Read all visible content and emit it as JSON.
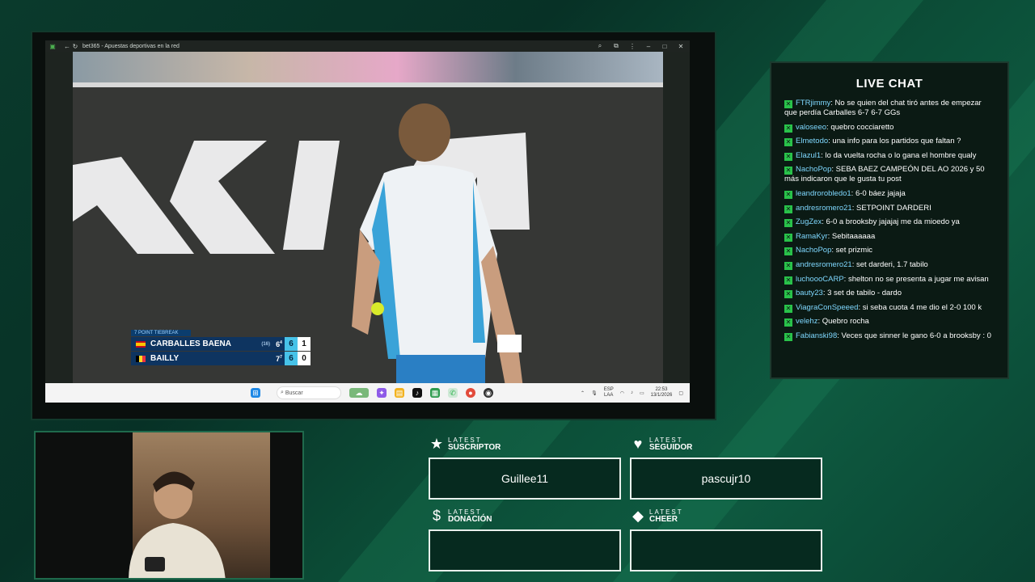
{
  "browser": {
    "title": "bet365 - Apuestas deportivas en la red",
    "taskbar_search": "Buscar",
    "tray_lang_1": "ESP",
    "tray_lang_2": "LAA",
    "time": "22:53",
    "date": "13/1/2026"
  },
  "scoreboard": {
    "label": "7 POINT TIEBREAK",
    "players": [
      {
        "name": "CARBALLES BAENA",
        "seed": "(16)",
        "prev_set": "6",
        "prev_sup": "4",
        "set": "6",
        "game": "1"
      },
      {
        "name": "BAILLY",
        "seed": "",
        "prev_set": "7",
        "prev_sup": "7",
        "set": "6",
        "game": "0"
      }
    ]
  },
  "chat": {
    "title": "LIVE CHAT",
    "messages": [
      {
        "user": "FTRjimmy",
        "text": "No se quien del chat tiró antes de empezar que perdía Carballes 6-7 6-7 GGs"
      },
      {
        "user": "valoseeo",
        "text": "quebro cocciaretto"
      },
      {
        "user": "Elmetodo",
        "text": "una info para los partidos que faltan ?"
      },
      {
        "user": "Elazul1",
        "text": "lo da vuelta rocha o lo gana el hombre qualy"
      },
      {
        "user": "NachoPop",
        "text": "SEBA BAEZ CAMPEÓN DEL AO 2026 y 50 más indicaron que le gusta tu post"
      },
      {
        "user": "leandrorobledo1",
        "text": "6-0 báez jajaja"
      },
      {
        "user": "andresromero21",
        "text": "SETPOINT DARDERI"
      },
      {
        "user": "ZugZex",
        "text": "6-0 a brooksby jajajaj me da mioedo ya"
      },
      {
        "user": "RamaKyr",
        "text": "Sebitaaaaaa"
      },
      {
        "user": "NachoPop",
        "text": "set prizmic"
      },
      {
        "user": "andresromero21",
        "text": "set darderi, 1.7 tabilo"
      },
      {
        "user": "luchoooCARP",
        "text": "shelton no se presenta a jugar me avisan"
      },
      {
        "user": "bauty23",
        "text": "3 set de tabilo - dardo"
      },
      {
        "user": "ViagraConSpeeed",
        "text": "si seba cuota 4 me dio el 2-0 100 k"
      },
      {
        "user": "velehz",
        "text": "Quebro rocha"
      },
      {
        "user": "Fabianski98",
        "text": "Veces que sinner le gano 6-0 a brooksby : 0"
      }
    ]
  },
  "alerts": {
    "subscriber": {
      "small": "LATEST",
      "main": "SUSCRIPTOR",
      "value": "Guillee11"
    },
    "follower": {
      "small": "LATEST",
      "main": "SEGUIDOR",
      "value": "pascujr10"
    },
    "donation": {
      "small": "LATEST",
      "main": "DONACIÓN",
      "value": ""
    },
    "cheer": {
      "small": "LATEST",
      "main": "CHEER",
      "value": ""
    }
  },
  "colors": {
    "accent": "#29c24a",
    "username": "#7fd8ff",
    "panel_border": "#e8f0ec"
  }
}
